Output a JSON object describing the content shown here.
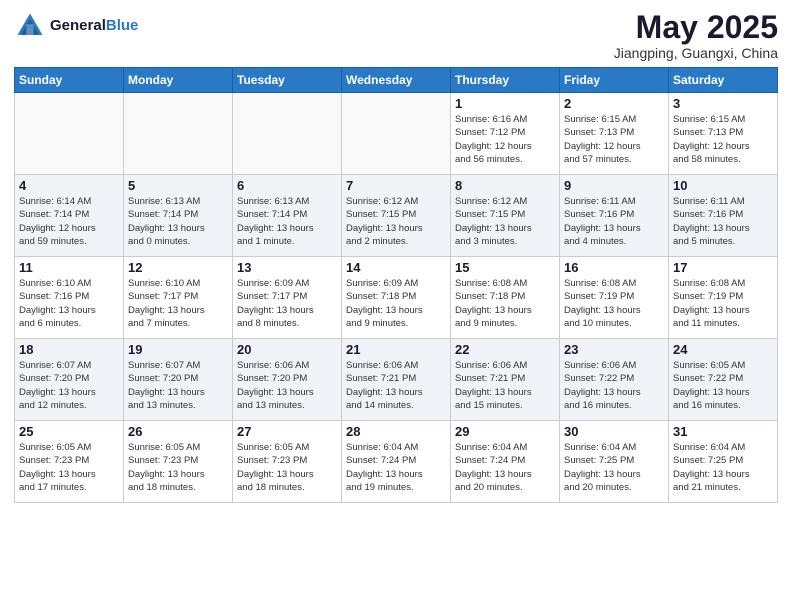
{
  "header": {
    "logo_line1": "General",
    "logo_line2": "Blue",
    "month_title": "May 2025",
    "location": "Jiangping, Guangxi, China"
  },
  "days_of_week": [
    "Sunday",
    "Monday",
    "Tuesday",
    "Wednesday",
    "Thursday",
    "Friday",
    "Saturday"
  ],
  "weeks": [
    [
      {
        "day": "",
        "info": ""
      },
      {
        "day": "",
        "info": ""
      },
      {
        "day": "",
        "info": ""
      },
      {
        "day": "",
        "info": ""
      },
      {
        "day": "1",
        "info": "Sunrise: 6:16 AM\nSunset: 7:12 PM\nDaylight: 12 hours\nand 56 minutes."
      },
      {
        "day": "2",
        "info": "Sunrise: 6:15 AM\nSunset: 7:13 PM\nDaylight: 12 hours\nand 57 minutes."
      },
      {
        "day": "3",
        "info": "Sunrise: 6:15 AM\nSunset: 7:13 PM\nDaylight: 12 hours\nand 58 minutes."
      }
    ],
    [
      {
        "day": "4",
        "info": "Sunrise: 6:14 AM\nSunset: 7:14 PM\nDaylight: 12 hours\nand 59 minutes."
      },
      {
        "day": "5",
        "info": "Sunrise: 6:13 AM\nSunset: 7:14 PM\nDaylight: 13 hours\nand 0 minutes."
      },
      {
        "day": "6",
        "info": "Sunrise: 6:13 AM\nSunset: 7:14 PM\nDaylight: 13 hours\nand 1 minute."
      },
      {
        "day": "7",
        "info": "Sunrise: 6:12 AM\nSunset: 7:15 PM\nDaylight: 13 hours\nand 2 minutes."
      },
      {
        "day": "8",
        "info": "Sunrise: 6:12 AM\nSunset: 7:15 PM\nDaylight: 13 hours\nand 3 minutes."
      },
      {
        "day": "9",
        "info": "Sunrise: 6:11 AM\nSunset: 7:16 PM\nDaylight: 13 hours\nand 4 minutes."
      },
      {
        "day": "10",
        "info": "Sunrise: 6:11 AM\nSunset: 7:16 PM\nDaylight: 13 hours\nand 5 minutes."
      }
    ],
    [
      {
        "day": "11",
        "info": "Sunrise: 6:10 AM\nSunset: 7:16 PM\nDaylight: 13 hours\nand 6 minutes."
      },
      {
        "day": "12",
        "info": "Sunrise: 6:10 AM\nSunset: 7:17 PM\nDaylight: 13 hours\nand 7 minutes."
      },
      {
        "day": "13",
        "info": "Sunrise: 6:09 AM\nSunset: 7:17 PM\nDaylight: 13 hours\nand 8 minutes."
      },
      {
        "day": "14",
        "info": "Sunrise: 6:09 AM\nSunset: 7:18 PM\nDaylight: 13 hours\nand 9 minutes."
      },
      {
        "day": "15",
        "info": "Sunrise: 6:08 AM\nSunset: 7:18 PM\nDaylight: 13 hours\nand 9 minutes."
      },
      {
        "day": "16",
        "info": "Sunrise: 6:08 AM\nSunset: 7:19 PM\nDaylight: 13 hours\nand 10 minutes."
      },
      {
        "day": "17",
        "info": "Sunrise: 6:08 AM\nSunset: 7:19 PM\nDaylight: 13 hours\nand 11 minutes."
      }
    ],
    [
      {
        "day": "18",
        "info": "Sunrise: 6:07 AM\nSunset: 7:20 PM\nDaylight: 13 hours\nand 12 minutes."
      },
      {
        "day": "19",
        "info": "Sunrise: 6:07 AM\nSunset: 7:20 PM\nDaylight: 13 hours\nand 13 minutes."
      },
      {
        "day": "20",
        "info": "Sunrise: 6:06 AM\nSunset: 7:20 PM\nDaylight: 13 hours\nand 13 minutes."
      },
      {
        "day": "21",
        "info": "Sunrise: 6:06 AM\nSunset: 7:21 PM\nDaylight: 13 hours\nand 14 minutes."
      },
      {
        "day": "22",
        "info": "Sunrise: 6:06 AM\nSunset: 7:21 PM\nDaylight: 13 hours\nand 15 minutes."
      },
      {
        "day": "23",
        "info": "Sunrise: 6:06 AM\nSunset: 7:22 PM\nDaylight: 13 hours\nand 16 minutes."
      },
      {
        "day": "24",
        "info": "Sunrise: 6:05 AM\nSunset: 7:22 PM\nDaylight: 13 hours\nand 16 minutes."
      }
    ],
    [
      {
        "day": "25",
        "info": "Sunrise: 6:05 AM\nSunset: 7:23 PM\nDaylight: 13 hours\nand 17 minutes."
      },
      {
        "day": "26",
        "info": "Sunrise: 6:05 AM\nSunset: 7:23 PM\nDaylight: 13 hours\nand 18 minutes."
      },
      {
        "day": "27",
        "info": "Sunrise: 6:05 AM\nSunset: 7:23 PM\nDaylight: 13 hours\nand 18 minutes."
      },
      {
        "day": "28",
        "info": "Sunrise: 6:04 AM\nSunset: 7:24 PM\nDaylight: 13 hours\nand 19 minutes."
      },
      {
        "day": "29",
        "info": "Sunrise: 6:04 AM\nSunset: 7:24 PM\nDaylight: 13 hours\nand 20 minutes."
      },
      {
        "day": "30",
        "info": "Sunrise: 6:04 AM\nSunset: 7:25 PM\nDaylight: 13 hours\nand 20 minutes."
      },
      {
        "day": "31",
        "info": "Sunrise: 6:04 AM\nSunset: 7:25 PM\nDaylight: 13 hours\nand 21 minutes."
      }
    ]
  ]
}
